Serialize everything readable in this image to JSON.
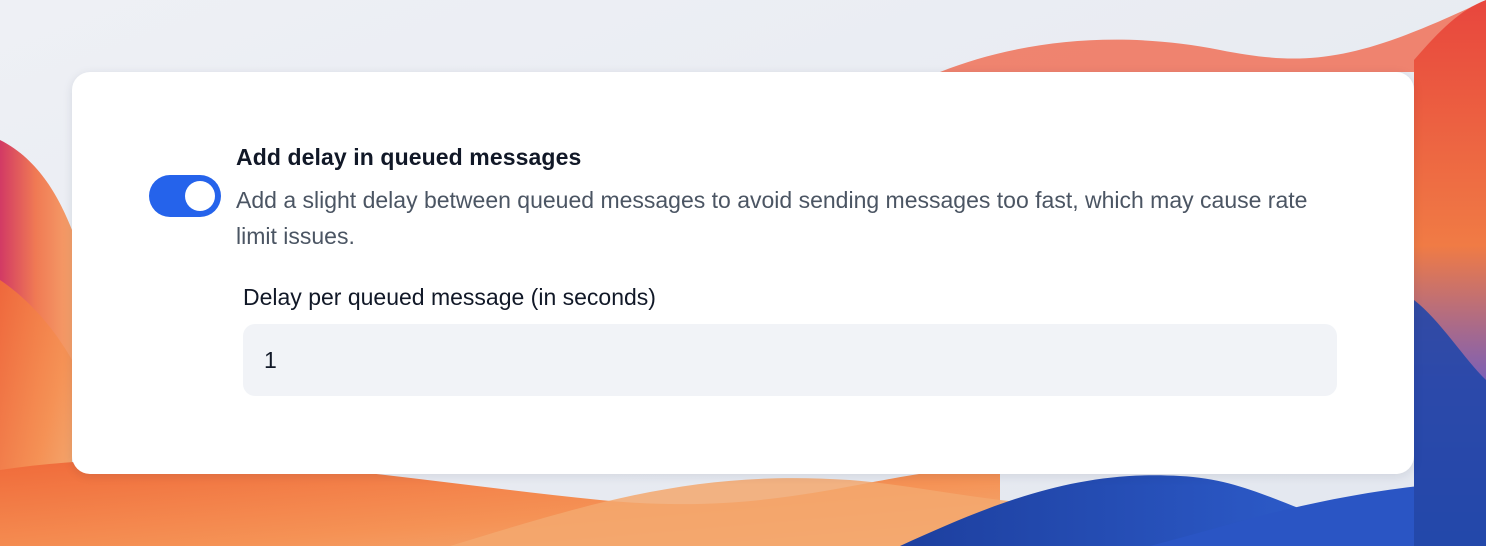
{
  "setting": {
    "title": "Add delay in queued messages",
    "description": "Add a slight delay between queued messages to avoid sending messages too fast, which may cause rate limit issues.",
    "enabled": true
  },
  "delay_field": {
    "label": "Delay per queued message (in seconds)",
    "value": "1"
  },
  "colors": {
    "accent": "#2563eb",
    "title_text": "#111827",
    "description_text": "#4b5563",
    "input_background": "#f1f3f7"
  },
  "icons": {
    "toggle": "toggle-switch-on"
  }
}
